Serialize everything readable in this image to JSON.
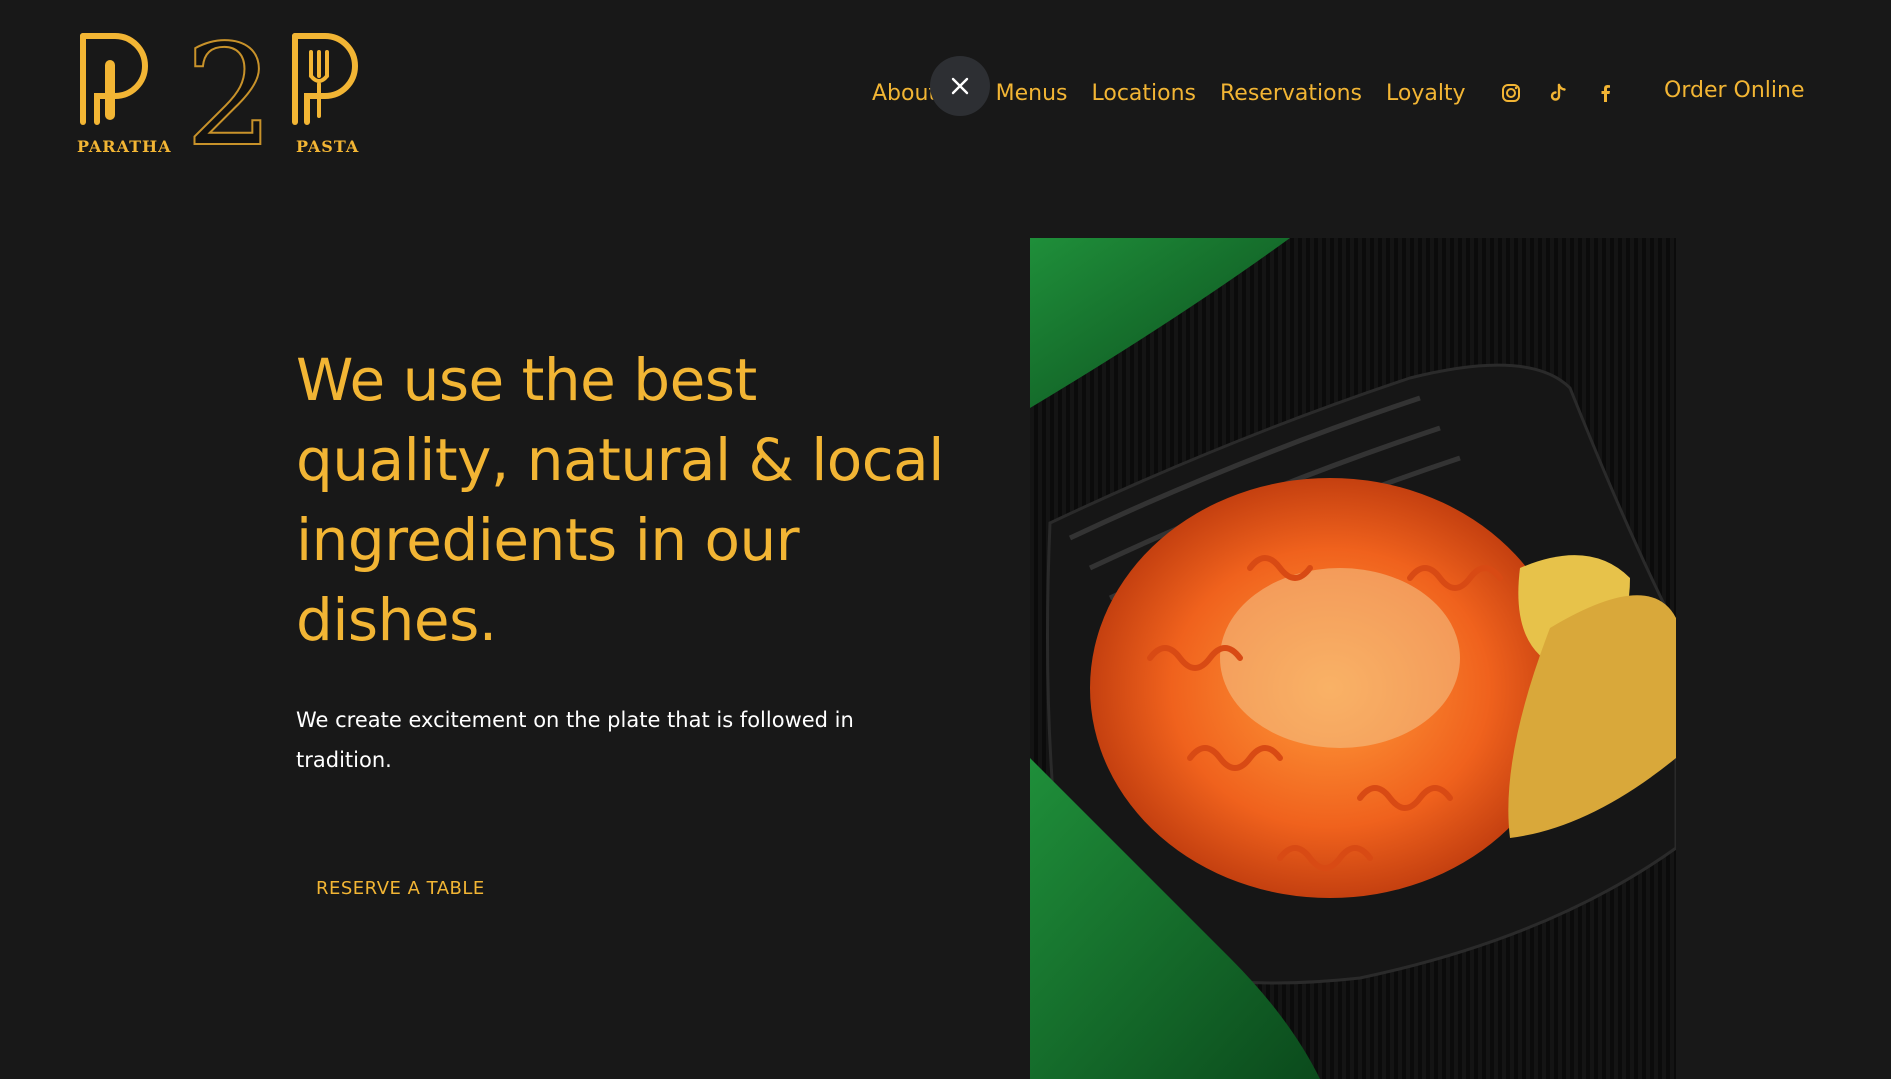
{
  "brand": {
    "left_caption": "PARATHA",
    "center_numeral": "2",
    "right_caption": "PASTA"
  },
  "nav": {
    "items": [
      "About Us",
      "Menus",
      "Locations",
      "Reservations",
      "Loyalty"
    ],
    "social": [
      "instagram-icon",
      "tiktok-icon",
      "facebook-icon"
    ],
    "order_online": "Order Online",
    "close_icon": "close-icon"
  },
  "hero": {
    "title": "We use the best quality, natural & local ingredients in our dishes.",
    "subtitle": "We create excitement on the plate that is followed in tradition.",
    "cta": "RESERVE A TABLE"
  },
  "colors": {
    "background": "#181818",
    "accent": "#f2b534",
    "body_text": "#ffffff"
  }
}
